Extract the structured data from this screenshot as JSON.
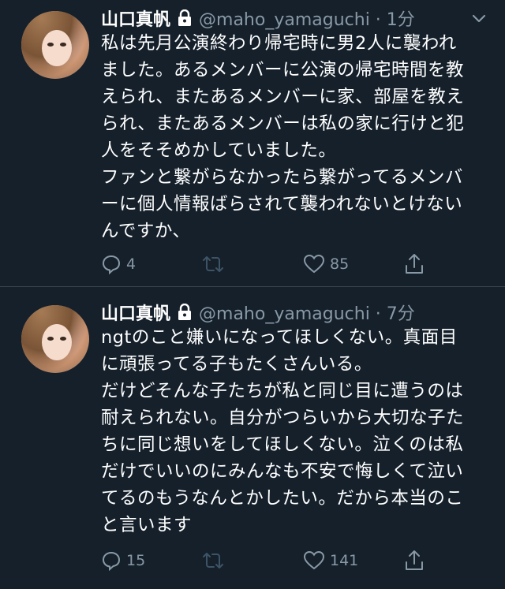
{
  "tweets": [
    {
      "name": "山口真帆",
      "handle": "@maho_yamaguchi · 1分",
      "text": "私は先月公演終わり帰宅時に男2人に襲われ\nました。あるメンバーに公演の帰宅時間を教\nえられ、またあるメンバーに家、部屋を教え\nられ、またあるメンバーは私の家に行けと犯\n人をそそめかしていました。\nファンと繋がらなかったら繋がってるメンバ\nーに個人情報ばらされて襲われないとけない\nんですか、",
      "replies": "4",
      "retweets": "",
      "likes": "85"
    },
    {
      "name": "山口真帆",
      "handle": "@maho_yamaguchi · 7分",
      "text": "ngtのこと嫌いになってほしくない。真面目\nに頑張ってる子もたくさんいる。\nだけどそんな子たちが私と同じ目に遭うのは\n耐えられない。自分がつらいから大切な子た\nちに同じ想いをしてほしくない。泣くのは私\nだけでいいのにみんなも不安で悔しくて泣い\nてるのもうなんとかしたい。だから本当のこ\nと言います",
      "replies": "15",
      "retweets": "",
      "likes": "141"
    }
  ],
  "colors": {
    "background": "#15202b",
    "text": "#ffffff",
    "secondary": "#8899a6",
    "divider": "#38444d"
  },
  "icons": [
    "lock-icon",
    "chevron-down-icon",
    "reply-icon",
    "retweet-icon",
    "like-icon",
    "share-icon"
  ]
}
